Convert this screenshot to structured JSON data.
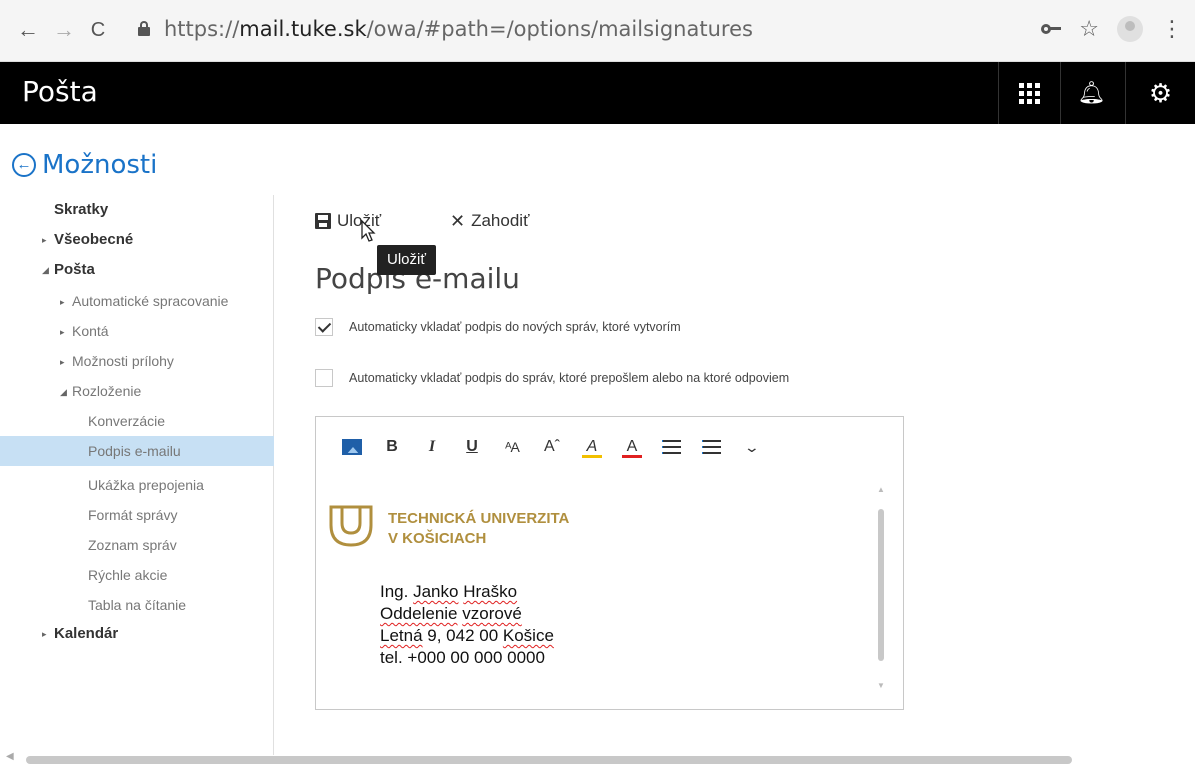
{
  "browser": {
    "url_prefix": "https://",
    "url_host": "mail.tuke.sk",
    "url_path": "/owa/#path=/options/mailsignatures"
  },
  "app": {
    "title": "Pošta"
  },
  "options": {
    "label": "Možnosti"
  },
  "sidebar": {
    "items": [
      {
        "label": "Skratky"
      },
      {
        "label": "Všeobecné"
      },
      {
        "label": "Pošta"
      },
      {
        "label": "Automatické spracovanie"
      },
      {
        "label": "Kontá"
      },
      {
        "label": "Možnosti prílohy"
      },
      {
        "label": "Rozloženie"
      },
      {
        "label": "Konverzácie"
      },
      {
        "label": "Podpis e-mailu"
      },
      {
        "label": "Ukážka prepojenia"
      },
      {
        "label": "Formát správy"
      },
      {
        "label": "Zoznam správ"
      },
      {
        "label": "Rýchle akcie"
      },
      {
        "label": "Tabla na čítanie"
      },
      {
        "label": "Kalendár"
      }
    ]
  },
  "toolbar": {
    "save_label": "Uložiť",
    "discard_label": "Zahodiť",
    "tooltip": "Uložiť"
  },
  "page": {
    "title": "Podpis e-mailu"
  },
  "settings": {
    "auto_new_label": "Automaticky vkladať podpis do nových správ, ktoré vytvorím",
    "auto_new_checked": true,
    "auto_reply_label": "Automaticky vkladať podpis do správ, ktoré prepošlem alebo na ktoré odpoviem",
    "auto_reply_checked": false
  },
  "editor": {
    "logo_line1": "TECHNICKÁ UNIVERZITA",
    "logo_line2": "V KOŠICIACH",
    "sig_name_a": "Ing. ",
    "sig_name_b": "Janko",
    "sig_name_c": " ",
    "sig_name_d": "Hraško",
    "sig_dept_a": "Oddelenie",
    "sig_dept_b": " ",
    "sig_dept_c": "vzorové",
    "sig_addr_a": "Letná",
    "sig_addr_b": " 9, 042 00 ",
    "sig_addr_c": "Košice",
    "sig_phone": "tel. +000 00 000 0000",
    "colors": {
      "highlight": "#f2c000",
      "font_color": "#e02020",
      "logo_gold": "#b08f3e"
    }
  },
  "colors": {
    "accent": "#1a73c8",
    "selected_bg": "#c7e0f4",
    "header_bg": "#000000"
  }
}
